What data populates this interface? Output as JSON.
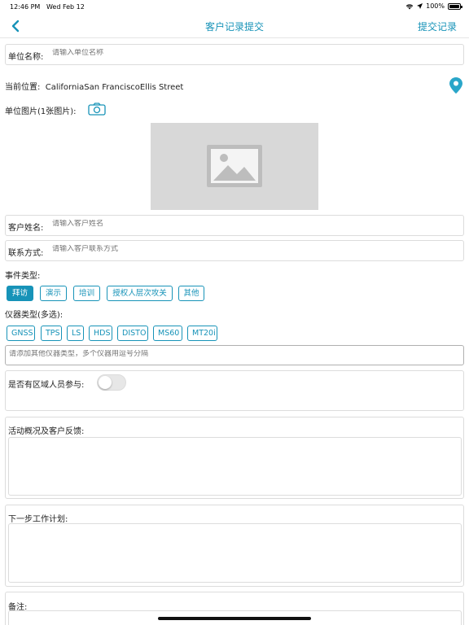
{
  "status_bar": {
    "time": "12:46 PM",
    "date": "Wed Feb 12",
    "battery": "100%",
    "battery_level": 1.0
  },
  "nav": {
    "title": "客户记录提交",
    "submit_label": "提交记录",
    "accent_color": "#1793b8"
  },
  "unit_name": {
    "label": "单位名称:",
    "placeholder": "请输入单位名称"
  },
  "location": {
    "label": "当前位置:",
    "value": "CaliforniaSan FranciscoEllis Street"
  },
  "unit_image": {
    "label": "单位图片(1张图片):"
  },
  "customer_name": {
    "label": "客户姓名:",
    "placeholder": "请输入客户姓名"
  },
  "contact": {
    "label": "联系方式:",
    "placeholder": "请输入客户联系方式"
  },
  "event_type": {
    "label": "事件类型:",
    "options": [
      "拜访",
      "演示",
      "培训",
      "授权人层次攻关",
      "其他"
    ],
    "selected": "拜访"
  },
  "instrument_type": {
    "label": "仪器类型(多选):",
    "options": [
      "GNSS",
      "TPS",
      "LS",
      "HDS",
      "DISTO",
      "MS60",
      "MT20i"
    ],
    "other_placeholder": "请添加其他仪器类型，多个仪器用逗号分隔"
  },
  "regional_staff": {
    "label": "是否有区域人员参与:",
    "enabled": false
  },
  "activity_feedback": {
    "label": "活动概况及客户反馈:"
  },
  "next_plan": {
    "label": "下一步工作计划:"
  },
  "remarks": {
    "label": "备注:"
  }
}
